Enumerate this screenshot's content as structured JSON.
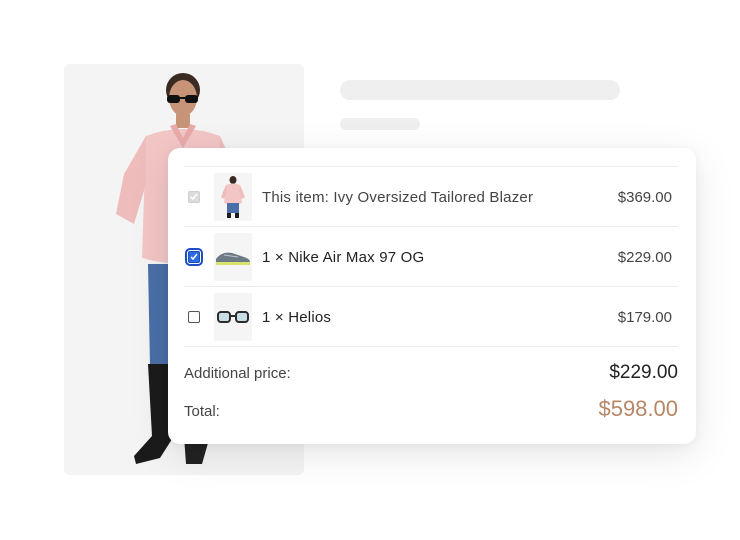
{
  "page": {
    "card_items": [
      {
        "label": "This item: Ivy Oversized Tailored Blazer",
        "price": "$369.00",
        "checkbox": "disabled-checked",
        "thumb_icon": "blazer-thumbnail"
      },
      {
        "label": "1 × Nike Air Max 97 OG",
        "price": "$229.00",
        "checkbox": "checked",
        "thumb_icon": "sneaker-thumbnail"
      },
      {
        "label": "1 × Helios",
        "price": "$179.00",
        "checkbox": "unchecked",
        "thumb_icon": "sunglasses-thumbnail"
      }
    ],
    "summary": {
      "additional_label": "Additional price:",
      "additional_value": "$229.00",
      "total_label": "Total:",
      "total_value": "$598.00"
    }
  },
  "colors": {
    "accent_total": "#b78665",
    "checkbox_checked": "#2d6be0"
  }
}
